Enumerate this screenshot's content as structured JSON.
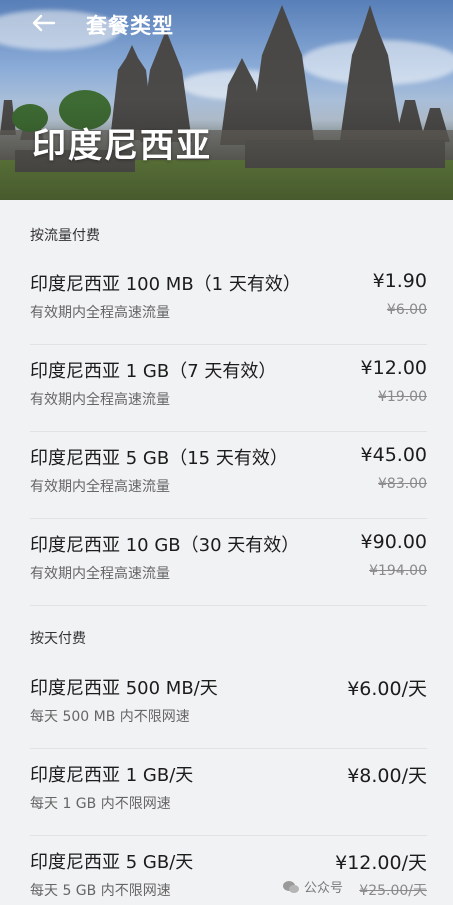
{
  "header": {
    "title": "套餐类型",
    "country": "印度尼西亚",
    "back_icon": "back-arrow-icon"
  },
  "sections": [
    {
      "title": "按流量付费",
      "plans": [
        {
          "name": "印度尼西亚 100 MB（1 天有效）",
          "desc": "有效期内全程高速流量",
          "price": "¥1.90",
          "original": "¥6.00"
        },
        {
          "name": "印度尼西亚 1 GB（7 天有效）",
          "desc": "有效期内全程高速流量",
          "price": "¥12.00",
          "original": "¥19.00"
        },
        {
          "name": "印度尼西亚 5 GB（15 天有效）",
          "desc": "有效期内全程高速流量",
          "price": "¥45.00",
          "original": "¥83.00"
        },
        {
          "name": "印度尼西亚 10 GB（30 天有效）",
          "desc": "有效期内全程高速流量",
          "price": "¥90.00",
          "original": "¥194.00"
        }
      ]
    },
    {
      "title": "按天付费",
      "plans": [
        {
          "name": "印度尼西亚 500 MB/天",
          "desc": "每天 500 MB 内不限网速",
          "price": "¥6.00/天",
          "original": ""
        },
        {
          "name": "印度尼西亚 1 GB/天",
          "desc": "每天 1 GB 内不限网速",
          "price": "¥8.00/天",
          "original": ""
        },
        {
          "name": "印度尼西亚 5 GB/天",
          "desc": "每天 5 GB 内不限网速",
          "price": "¥12.00/天",
          "original": "¥25.00/天"
        }
      ]
    }
  ],
  "watermark": {
    "text": "公众号",
    "icon": "wechat-icon"
  },
  "colors": {
    "background": "#f1f2f4",
    "text": "#1c1c1c",
    "muted": "#666666",
    "strike": "#8a8a8a"
  }
}
